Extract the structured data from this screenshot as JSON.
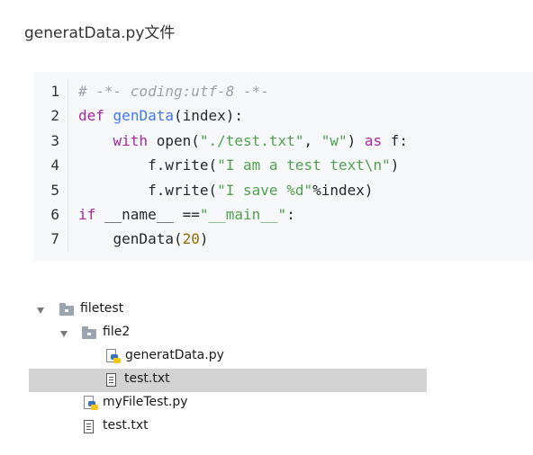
{
  "page": {
    "heading": "generatData.py文件"
  },
  "code": {
    "lines": [
      {
        "n": "1",
        "segments": [
          {
            "t": "# -*- coding:utf-8 -*-",
            "c": "cmt"
          }
        ]
      },
      {
        "n": "2",
        "segments": [
          {
            "t": "def",
            "c": "kw"
          },
          {
            "t": " ",
            "c": ""
          },
          {
            "t": "genData",
            "c": "fn"
          },
          {
            "t": "(index):",
            "c": ""
          }
        ]
      },
      {
        "n": "3",
        "segments": [
          {
            "t": "    ",
            "c": ""
          },
          {
            "t": "with",
            "c": "kw"
          },
          {
            "t": " open(",
            "c": ""
          },
          {
            "t": "\"./test.txt\"",
            "c": "str"
          },
          {
            "t": ", ",
            "c": ""
          },
          {
            "t": "\"w\"",
            "c": "str"
          },
          {
            "t": ") ",
            "c": ""
          },
          {
            "t": "as",
            "c": "kw"
          },
          {
            "t": " f:",
            "c": ""
          }
        ]
      },
      {
        "n": "4",
        "segments": [
          {
            "t": "        f.write(",
            "c": ""
          },
          {
            "t": "\"I am a test text\\n\"",
            "c": "str"
          },
          {
            "t": ")",
            "c": ""
          }
        ]
      },
      {
        "n": "5",
        "segments": [
          {
            "t": "        f.write(",
            "c": ""
          },
          {
            "t": "\"I save %d\"",
            "c": "str"
          },
          {
            "t": "%index)",
            "c": ""
          }
        ]
      },
      {
        "n": "6",
        "segments": [
          {
            "t": "if",
            "c": "kw"
          },
          {
            "t": " __name__ ==",
            "c": ""
          },
          {
            "t": "\"__main__\"",
            "c": "str"
          },
          {
            "t": ":",
            "c": ""
          }
        ]
      },
      {
        "n": "7",
        "segments": [
          {
            "t": "    genData(",
            "c": ""
          },
          {
            "t": "20",
            "c": "num"
          },
          {
            "t": ")",
            "c": ""
          }
        ]
      }
    ]
  },
  "tree": {
    "items": [
      {
        "label": "filetest",
        "icon": "folder-icon",
        "expanded": true,
        "selected": false
      },
      {
        "label": "file2",
        "icon": "folder-icon",
        "expanded": true,
        "selected": false
      },
      {
        "label": "generatData.py",
        "icon": "python-file-icon",
        "selected": false
      },
      {
        "label": "test.txt",
        "icon": "text-file-icon",
        "selected": true
      },
      {
        "label": "myFileTest.py",
        "icon": "python-file-icon",
        "selected": false
      },
      {
        "label": "test.txt",
        "icon": "text-file-icon",
        "selected": false
      }
    ]
  }
}
